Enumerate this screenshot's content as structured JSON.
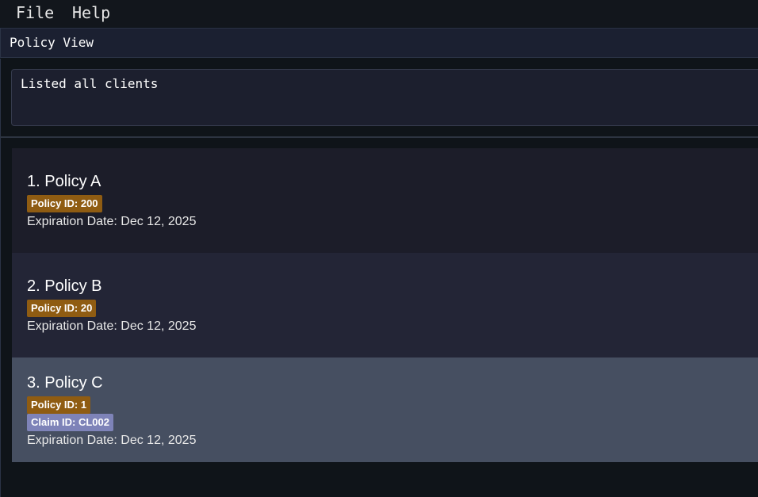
{
  "menu": {
    "file_label": "File",
    "help_label": "Help"
  },
  "view": {
    "title": "Policy View"
  },
  "result": {
    "message": "Listed all clients"
  },
  "policies": [
    {
      "title": "1. Policy A",
      "policy_id_tag": "Policy ID: 200",
      "expiration": "Expiration Date: Dec 12, 2025"
    },
    {
      "title": "2. Policy B",
      "policy_id_tag": "Policy ID: 20",
      "expiration": "Expiration Date: Dec 12, 2025"
    },
    {
      "title": "3. Policy C",
      "policy_id_tag": "Policy ID: 1",
      "claim_id_tag": "Claim ID: CL002",
      "expiration": "Expiration Date: Dec 12, 2025",
      "selected": true
    }
  ],
  "colors": {
    "background": "#0f1419",
    "panel": "#1b2031",
    "card_odd": "#1c1d29",
    "card_even": "#232536",
    "card_selected": "#464f61",
    "policy_tag": "#8f5c12",
    "claim_tag": "#7e83b8"
  }
}
